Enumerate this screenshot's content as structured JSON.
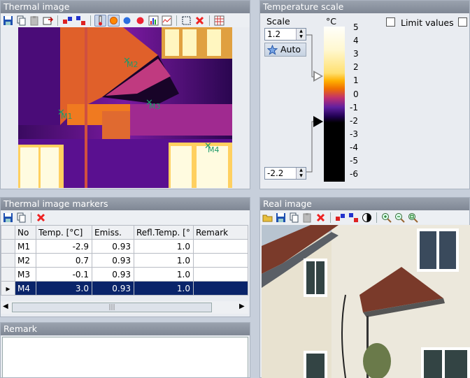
{
  "thermal_panel": {
    "title": "Thermal image",
    "markers": [
      {
        "label": "M1"
      },
      {
        "label": "M2"
      },
      {
        "label": "M3"
      },
      {
        "label": "M4"
      }
    ],
    "toolbar_icons": [
      "save-icon",
      "copy-icon",
      "paste-icon",
      "export-icon",
      "swap-icon",
      "palette-icon",
      "thermometer-icon",
      "sun-icon",
      "blue-dot-icon",
      "red-dot-icon",
      "histogram-icon",
      "profile-icon",
      "select-icon",
      "delete-icon",
      "grid-icon"
    ]
  },
  "temp_scale": {
    "title": "Temperature scale",
    "scale_label": "Scale",
    "unit": "°C",
    "max_value": "1.2",
    "min_value": "-2.2",
    "auto_label": "Auto",
    "limit_values_label": "Limit values",
    "ticks": [
      "5",
      "4",
      "3",
      "2",
      "1",
      "0",
      "-1",
      "-2",
      "-3",
      "-4",
      "-5",
      "-6"
    ]
  },
  "markers_panel": {
    "title": "Thermal image markers",
    "columns": [
      "No",
      "Temp. [°C]",
      "Emiss.",
      "Refl.Temp. [°",
      "Remark"
    ],
    "rows": [
      {
        "no": "M1",
        "temp": "-2.9",
        "emiss": "0.93",
        "refl": "1.0",
        "remark": ""
      },
      {
        "no": "M2",
        "temp": "0.7",
        "emiss": "0.93",
        "refl": "1.0",
        "remark": ""
      },
      {
        "no": "M3",
        "temp": "-0.1",
        "emiss": "0.93",
        "refl": "1.0",
        "remark": ""
      },
      {
        "no": "M4",
        "temp": "3.0",
        "emiss": "0.93",
        "refl": "1.0",
        "remark": ""
      }
    ],
    "selected_row": 3
  },
  "remark_panel": {
    "title": "Remark",
    "text": ""
  },
  "real_panel": {
    "title": "Real image"
  },
  "colors": {
    "selection": "#0a246a",
    "title_bar": "#8a929e",
    "marker": "#1f9a6a"
  }
}
